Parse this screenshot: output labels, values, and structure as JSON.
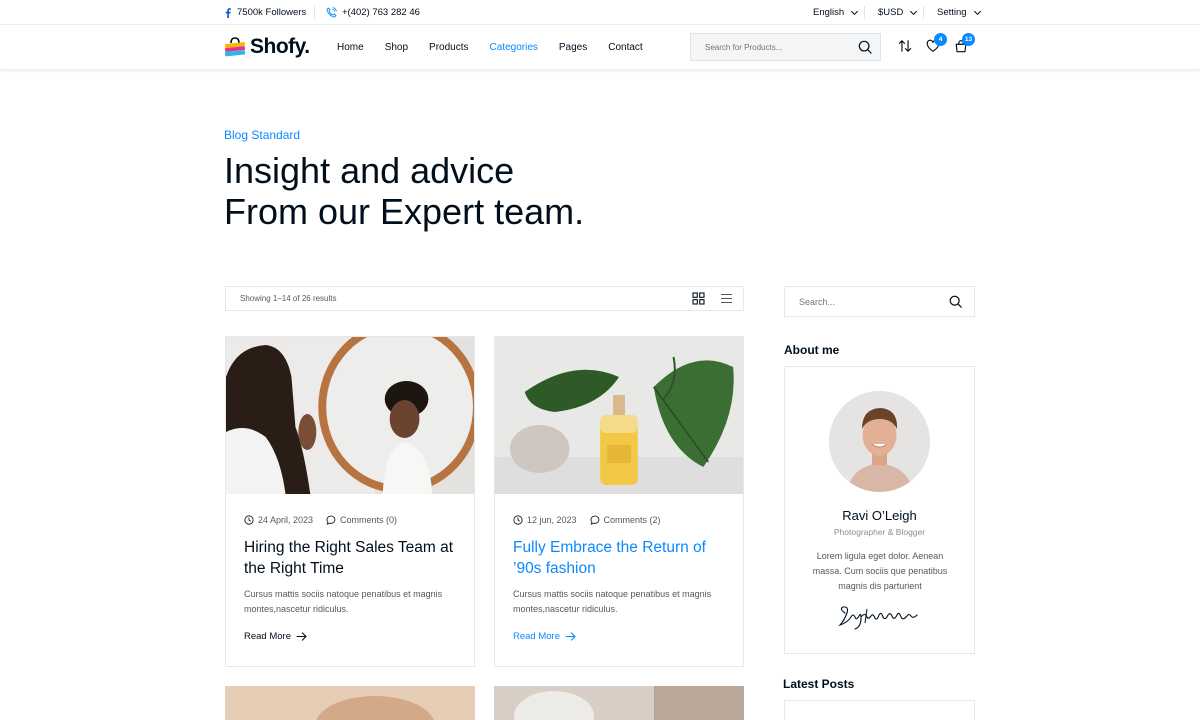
{
  "topbar": {
    "followers": "7500k Followers",
    "phone": "+(402) 763 282 46",
    "language": "English",
    "currency": "$USD",
    "setting": "Setting"
  },
  "header": {
    "logo": "Shofy.",
    "nav": [
      "Home",
      "Shop",
      "Products",
      "Categories",
      "Pages",
      "Contact"
    ],
    "active_nav": "Categories",
    "search_placeholder": "Search for Products...",
    "wishlist_count": "4",
    "cart_count": "13"
  },
  "hero": {
    "breadcrumb": "Blog Standard",
    "title_line1": "Insight and advice",
    "title_line2": "From our Expert team."
  },
  "toolbar": {
    "showing": "Showing 1–14 of 26 results"
  },
  "posts": [
    {
      "date": "24 April, 2023",
      "comments": "Comments (0)",
      "title": "Hiring the Right Sales Team at the Right Time",
      "excerpt": "Cursus mattis sociis natoque penatibus et magnis montes,nascetur ridiculus.",
      "read_more": "Read More"
    },
    {
      "date": "12 jun, 2023",
      "comments": "Comments (2)",
      "title": "Fully Embrace the Return of ’90s fashion",
      "excerpt": "Cursus mattis sociis natoque penatibus et magnis montes,nascetur ridiculus.",
      "read_more": "Read More"
    }
  ],
  "sidebar": {
    "search_placeholder": "Search...",
    "about_title": "About me",
    "about_name": "Ravi O’Leigh",
    "about_role": "Photographer & Blogger",
    "about_text": "Lorem ligula eget dolor. Aenean massa. Cum sociis que penatibus magnis dis parturient",
    "latest_title": "Latest Posts"
  },
  "colors": {
    "accent": "#0989ff",
    "text": "#010f1c",
    "muted": "#55585b",
    "border": "#e6e7e8"
  }
}
